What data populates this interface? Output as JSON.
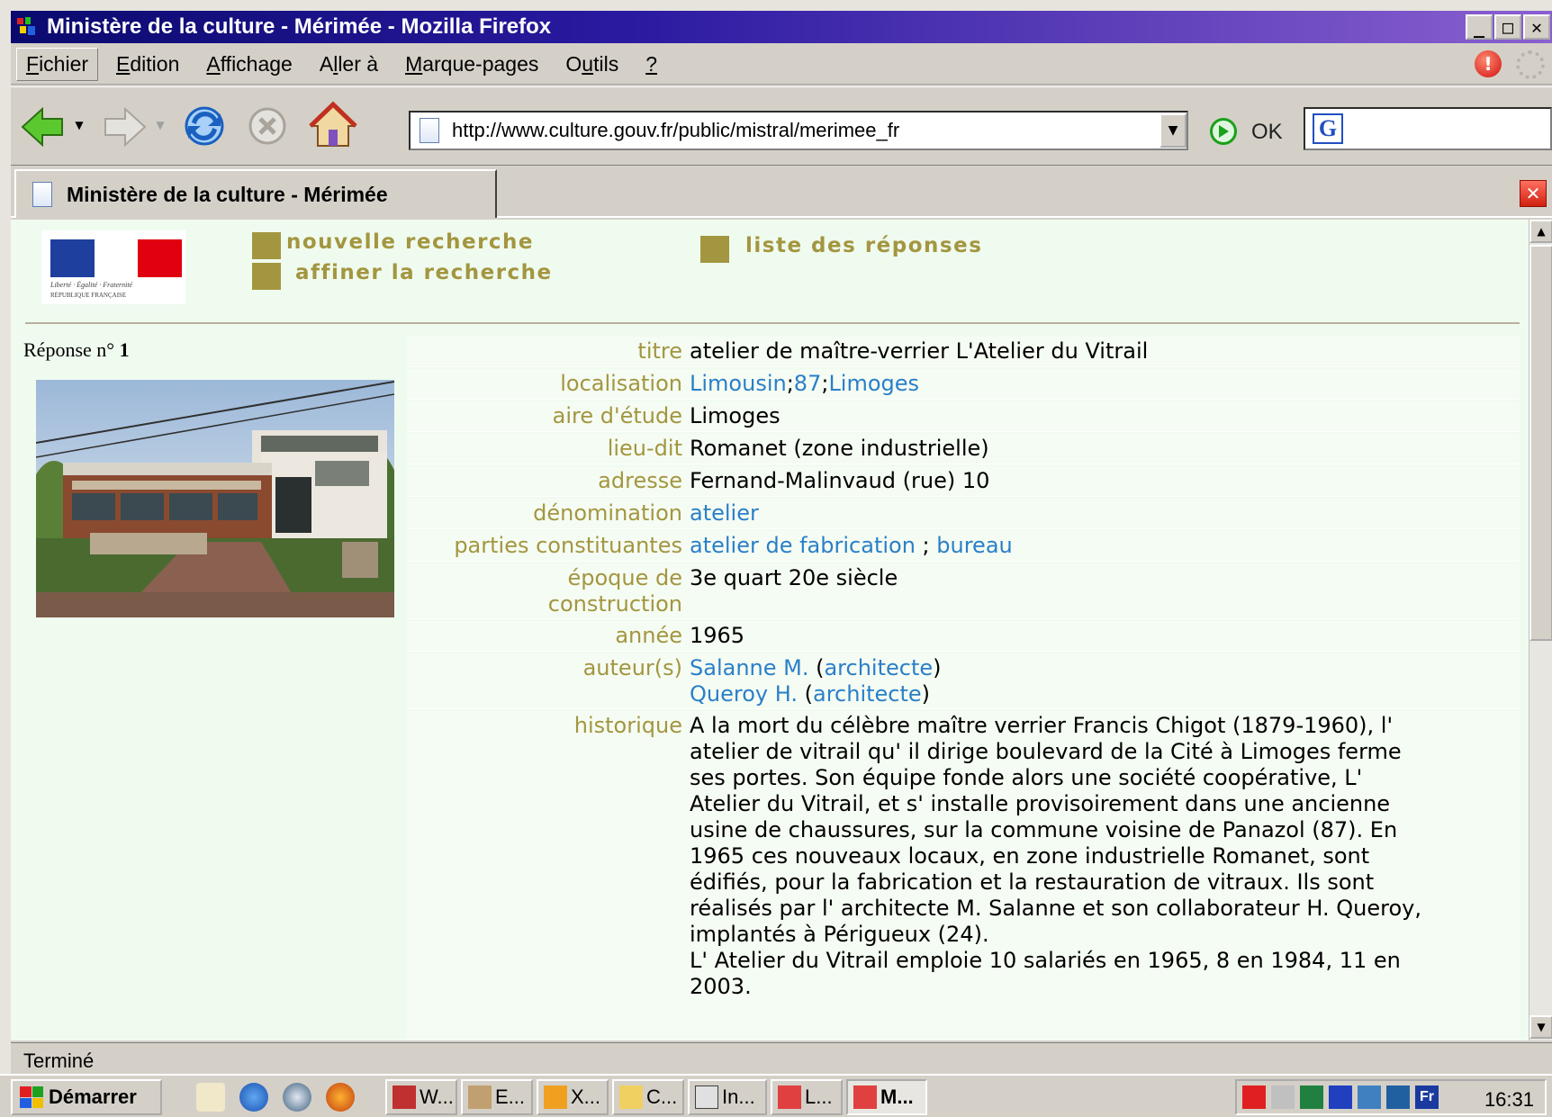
{
  "window": {
    "title": "Ministère de la culture - Mérimée - Mozilla Firefox",
    "minimize": "_",
    "maximize": "□",
    "close": "✕"
  },
  "menu": {
    "items": [
      {
        "key": "F",
        "rest": "ichier"
      },
      {
        "key": "E",
        "rest": "dition"
      },
      {
        "key": "A",
        "rest": "ffichage"
      },
      {
        "pre": "A",
        "key": "l",
        "rest": "ler à"
      },
      {
        "key": "M",
        "rest": "arque-pages"
      },
      {
        "pre": "O",
        "key": "u",
        "rest": "tils"
      },
      {
        "key": "?",
        "rest": ""
      }
    ]
  },
  "navbar": {
    "url": "http://www.culture.gouv.fr/public/mistral/merimee_fr",
    "go_label": "OK"
  },
  "tab": {
    "label": "Ministère de la culture - Mérimée"
  },
  "page": {
    "logo": {
      "motto": "Liberté · Égalité · Fraternité",
      "country": "RÉPUBLIQUE FRANÇAISE",
      "flag_colors": [
        "#1f3f9e",
        "#ffffff",
        "#e1000f"
      ]
    },
    "links": {
      "new_search": "nouvelle recherche",
      "refine_search": "affiner la recherche",
      "results_list": "liste des réponses"
    },
    "answer_label": "Réponse n°",
    "answer_number": "1",
    "record": {
      "titre": {
        "label": "titre",
        "value": "atelier de maître-verrier L'Atelier du Vitrail"
      },
      "localisation": {
        "label": "localisation",
        "region": "Limousin",
        "dept": "87",
        "city": "Limoges",
        "sep": ";"
      },
      "aire": {
        "label": "aire d'étude",
        "value": "Limoges"
      },
      "lieu_dit": {
        "label": "lieu-dit",
        "value": "Romanet (zone industrielle)"
      },
      "adresse": {
        "label": "adresse",
        "value": "Fernand-Malinvaud (rue) 10"
      },
      "denomination": {
        "label": "dénomination",
        "value": "atelier"
      },
      "parties": {
        "label": "parties constituantes",
        "part1": "atelier de fabrication",
        "sep": " ; ",
        "part2": "bureau"
      },
      "epoque": {
        "label_line1": "époque de",
        "label_line2": "construction",
        "value": "3e quart 20e siècle"
      },
      "annee": {
        "label": "année",
        "value": "1965"
      },
      "auteurs": {
        "label": "auteur(s)",
        "list": [
          {
            "name": "Salanne M.",
            "role": "architecte"
          },
          {
            "name": "Queroy H.",
            "role": "architecte"
          }
        ]
      },
      "historique": {
        "label": "historique",
        "lines": [
          "A la mort du célèbre maître verrier Francis Chigot (1879-1960), l'",
          "atelier de vitrail qu' il dirige boulevard de la Cité à Limoges ferme",
          "ses portes. Son équipe fonde alors une société coopérative, L'",
          "Atelier du Vitrail, et s' installe provisoirement dans une ancienne",
          "usine de chaussures, sur la commune voisine de Panazol (87). En",
          "1965 ces nouveaux locaux, en zone industrielle Romanet, sont",
          "édifiés, pour la fabrication et la restauration de vitraux. Ils sont",
          "réalisés par l' architecte M. Salanne et son collaborateur H. Queroy,",
          "implantés à Périgueux (24).",
          "L' Atelier du Vitrail emploie 10 salariés en 1965, 8 en 1984, 11 en",
          "2003."
        ]
      }
    }
  },
  "status": {
    "text": "Terminé"
  },
  "taskbar": {
    "start_label": "Démarrer",
    "buttons": [
      "W...",
      "E...",
      "X...",
      "C...",
      "In...",
      "L...",
      "M..."
    ],
    "tray_lang": "Fr",
    "clock": "16:31"
  }
}
